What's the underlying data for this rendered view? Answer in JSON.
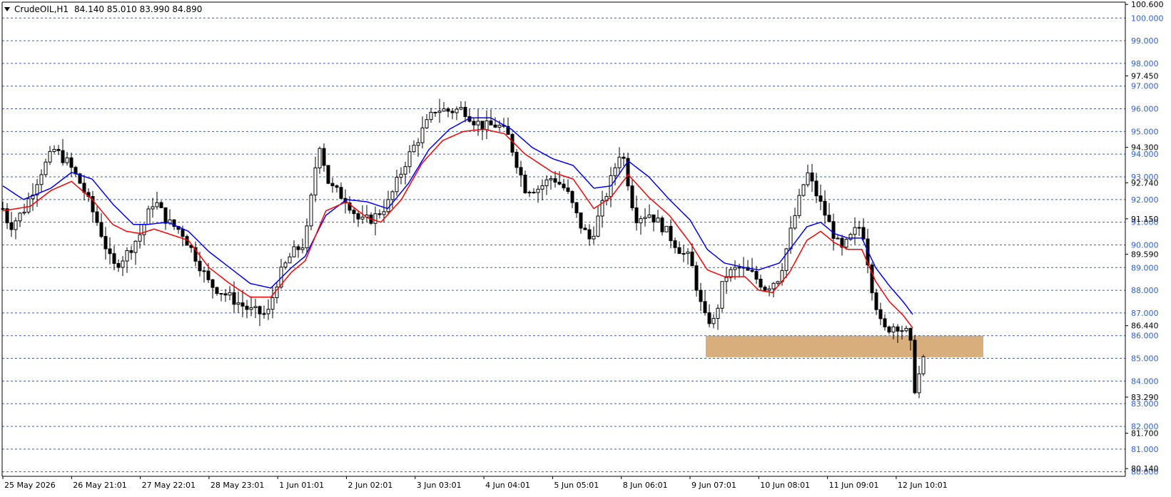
{
  "header": {
    "symbol_label": "CrudeOIL,H1",
    "ohlc_label": "84.140 85.010 83.990 84.890"
  },
  "colors": {
    "background": "#ffffff",
    "grid": "#2f5fd0",
    "candle": "#000000",
    "ema_fast": "#ff0000",
    "ema_slow": "#0000ff",
    "zone": "#d8ae7c",
    "level_tag_bg": "#ffffff",
    "level_tag_text": "#2f5fd0"
  },
  "icons": {
    "menu": "triangle-down-icon"
  },
  "chart_data": {
    "type": "candlestick",
    "symbol": "CrudeOIL",
    "timeframe": "H1",
    "ylim": [
      79.8,
      100.7
    ],
    "grid": true,
    "y_tick_labels": [
      "100.600",
      "97.450",
      "94.300",
      "92.740",
      "91.150",
      "89.590",
      "86.440",
      "83.290",
      "81.700",
      "80.140"
    ],
    "level_lines": [
      100,
      99,
      98,
      97,
      96,
      95,
      94,
      93,
      92,
      91,
      90,
      89,
      88,
      87,
      86,
      85,
      84,
      83,
      82,
      81,
      80
    ],
    "level_labels": [
      "100.000",
      "99.000",
      "98.000",
      "97.000",
      "96.000",
      "95.000",
      "94.000",
      "93.000",
      "92.000",
      "91.000",
      "90.000",
      "89.000",
      "88.000",
      "87.000",
      "86.000",
      "85.000",
      "84.000",
      "83.000",
      "82.000",
      "81.000",
      "80.000"
    ],
    "x_tick_labels": [
      "25 May 2026",
      "26 May 21:01",
      "27 May 22:01",
      "28 May 23:01",
      "1 Jun 01:01",
      "2 Jun 02:01",
      "3 Jun 03:01",
      "4 Jun 04:01",
      "5 Jun 05:01",
      "8 Jun 06:01",
      "9 Jun 07:01",
      "10 Jun 08:01",
      "11 Jun 09:01",
      "12 Jun 10:01"
    ],
    "support_zone": {
      "from": 85.05,
      "to": 86.0,
      "start_tick": 10
    },
    "close_path": [
      [
        0.0,
        91.6
      ],
      [
        0.1,
        90.8
      ],
      [
        0.3,
        91.5
      ],
      [
        0.55,
        93.2
      ],
      [
        0.75,
        94.2
      ],
      [
        0.95,
        93.6
      ],
      [
        1.15,
        92.6
      ],
      [
        1.4,
        90.8
      ],
      [
        1.6,
        89.0
      ],
      [
        1.8,
        89.6
      ],
      [
        2.0,
        90.5
      ],
      [
        2.2,
        92.0
      ],
      [
        2.4,
        91.0
      ],
      [
        2.6,
        90.6
      ],
      [
        2.8,
        89.5
      ],
      [
        3.0,
        88.3
      ],
      [
        3.3,
        87.7
      ],
      [
        3.6,
        87.1
      ],
      [
        3.85,
        86.9
      ],
      [
        4.0,
        88.5
      ],
      [
        4.2,
        89.6
      ],
      [
        4.4,
        90.1
      ],
      [
        4.6,
        94.6
      ],
      [
        4.75,
        92.6
      ],
      [
        5.0,
        92.0
      ],
      [
        5.2,
        91.0
      ],
      [
        5.4,
        91.2
      ],
      [
        5.6,
        91.8
      ],
      [
        5.85,
        93.6
      ],
      [
        6.1,
        95.0
      ],
      [
        6.3,
        96.0
      ],
      [
        6.5,
        95.9
      ],
      [
        6.7,
        96.0
      ],
      [
        6.85,
        95.5
      ],
      [
        7.0,
        95.2
      ],
      [
        7.2,
        95.3
      ],
      [
        7.35,
        94.8
      ],
      [
        7.6,
        92.5
      ],
      [
        7.8,
        92.5
      ],
      [
        8.0,
        93.0
      ],
      [
        8.2,
        92.4
      ],
      [
        8.4,
        90.9
      ],
      [
        8.55,
        90.2
      ],
      [
        8.8,
        92.4
      ],
      [
        9.0,
        94.3
      ],
      [
        9.2,
        91.2
      ],
      [
        9.4,
        91.4
      ],
      [
        9.6,
        90.8
      ],
      [
        9.9,
        89.6
      ],
      [
        10.0,
        89.4
      ],
      [
        10.2,
        86.8
      ],
      [
        10.35,
        86.6
      ],
      [
        10.5,
        88.6
      ],
      [
        10.7,
        89.0
      ],
      [
        10.9,
        88.7
      ],
      [
        11.1,
        88.1
      ],
      [
        11.3,
        88.6
      ],
      [
        11.5,
        91.0
      ],
      [
        11.7,
        93.2
      ],
      [
        11.9,
        91.8
      ],
      [
        12.0,
        91.1
      ],
      [
        12.2,
        89.7
      ],
      [
        12.4,
        90.6
      ],
      [
        12.5,
        90.9
      ],
      [
        12.65,
        88.1
      ],
      [
        12.8,
        86.2
      ],
      [
        13.0,
        86.5
      ],
      [
        13.2,
        86.0
      ],
      [
        13.25,
        83.5
      ],
      [
        13.4,
        84.9
      ]
    ],
    "ema_fast_path": [
      [
        0.0,
        91.5
      ],
      [
        0.4,
        91.7
      ],
      [
        0.7,
        92.4
      ],
      [
        1.0,
        92.8
      ],
      [
        1.3,
        92.0
      ],
      [
        1.6,
        90.9
      ],
      [
        1.8,
        90.6
      ],
      [
        2.0,
        90.5
      ],
      [
        2.2,
        90.7
      ],
      [
        2.4,
        90.5
      ],
      [
        2.7,
        90.2
      ],
      [
        3.0,
        89.0
      ],
      [
        3.3,
        88.3
      ],
      [
        3.6,
        87.7
      ],
      [
        3.9,
        87.7
      ],
      [
        4.2,
        88.8
      ],
      [
        4.4,
        89.3
      ],
      [
        4.7,
        91.5
      ],
      [
        5.0,
        91.9
      ],
      [
        5.3,
        91.2
      ],
      [
        5.5,
        91.0
      ],
      [
        5.8,
        92.0
      ],
      [
        6.1,
        93.6
      ],
      [
        6.4,
        94.6
      ],
      [
        6.7,
        95.0
      ],
      [
        7.0,
        95.1
      ],
      [
        7.3,
        94.9
      ],
      [
        7.6,
        94.0
      ],
      [
        8.0,
        93.2
      ],
      [
        8.3,
        92.9
      ],
      [
        8.6,
        91.6
      ],
      [
        8.85,
        92.1
      ],
      [
        9.1,
        93.1
      ],
      [
        9.4,
        92.1
      ],
      [
        9.7,
        91.3
      ],
      [
        10.0,
        90.1
      ],
      [
        10.25,
        88.9
      ],
      [
        10.5,
        88.6
      ],
      [
        10.8,
        88.6
      ],
      [
        11.0,
        88.0
      ],
      [
        11.2,
        87.9
      ],
      [
        11.45,
        88.8
      ],
      [
        11.7,
        90.2
      ],
      [
        11.9,
        90.6
      ],
      [
        12.1,
        90.1
      ],
      [
        12.3,
        89.8
      ],
      [
        12.5,
        89.8
      ],
      [
        12.7,
        88.4
      ],
      [
        12.9,
        87.5
      ],
      [
        13.1,
        86.9
      ],
      [
        13.25,
        86.3
      ]
    ],
    "ema_slow_path": [
      [
        0.0,
        92.6
      ],
      [
        0.3,
        92.0
      ],
      [
        0.7,
        92.5
      ],
      [
        1.0,
        93.2
      ],
      [
        1.3,
        92.9
      ],
      [
        1.6,
        91.8
      ],
      [
        1.9,
        90.9
      ],
      [
        2.1,
        90.9
      ],
      [
        2.4,
        91.0
      ],
      [
        2.7,
        90.6
      ],
      [
        3.0,
        89.7
      ],
      [
        3.3,
        89.0
      ],
      [
        3.6,
        88.3
      ],
      [
        3.9,
        88.1
      ],
      [
        4.2,
        89.0
      ],
      [
        4.4,
        89.5
      ],
      [
        4.7,
        91.3
      ],
      [
        5.0,
        92.0
      ],
      [
        5.3,
        91.9
      ],
      [
        5.6,
        91.6
      ],
      [
        5.9,
        92.7
      ],
      [
        6.2,
        94.2
      ],
      [
        6.5,
        95.1
      ],
      [
        6.8,
        95.6
      ],
      [
        7.1,
        95.6
      ],
      [
        7.4,
        95.1
      ],
      [
        7.7,
        94.3
      ],
      [
        8.0,
        93.8
      ],
      [
        8.3,
        93.5
      ],
      [
        8.6,
        92.5
      ],
      [
        8.85,
        92.6
      ],
      [
        9.1,
        93.7
      ],
      [
        9.4,
        93.0
      ],
      [
        9.7,
        92.0
      ],
      [
        10.0,
        91.1
      ],
      [
        10.25,
        89.8
      ],
      [
        10.5,
        89.2
      ],
      [
        10.8,
        89.0
      ],
      [
        11.0,
        88.9
      ],
      [
        11.3,
        89.2
      ],
      [
        11.5,
        90.0
      ],
      [
        11.7,
        90.8
      ],
      [
        11.9,
        91.0
      ],
      [
        12.1,
        90.5
      ],
      [
        12.3,
        90.3
      ],
      [
        12.5,
        90.3
      ],
      [
        12.7,
        89.0
      ],
      [
        12.9,
        88.2
      ],
      [
        13.1,
        87.5
      ],
      [
        13.25,
        86.9
      ]
    ],
    "wick_size": 0.55,
    "candle_seed": 7
  }
}
